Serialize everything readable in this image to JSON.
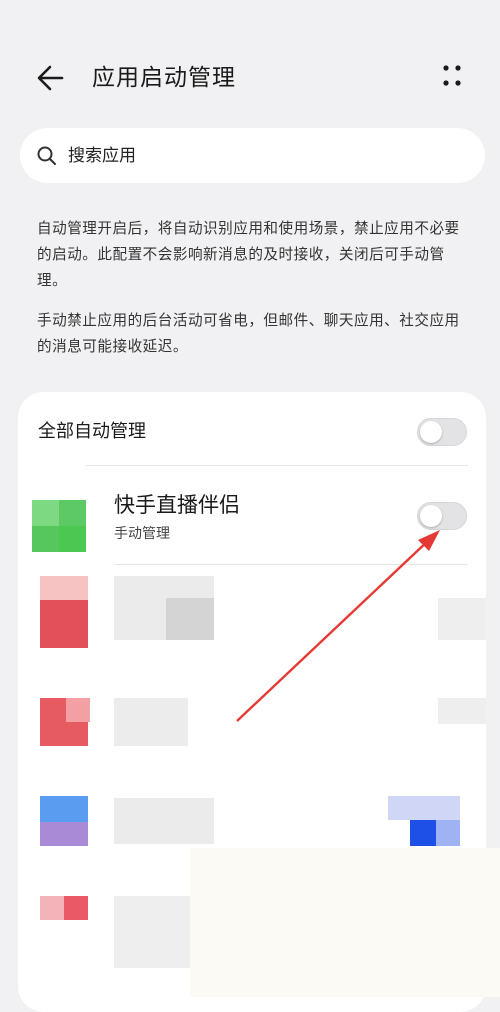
{
  "header": {
    "title": "应用启动管理"
  },
  "search": {
    "placeholder": "搜索应用"
  },
  "description": {
    "paragraph1": "自动管理开启后，将自动识别应用和使用场景，禁止应用不必要的启动。此配置不会影响新消息的及时接收，关闭后可手动管理。",
    "paragraph2": "手动禁止应用的后台活动可省电，但邮件、聊天应用、社交应用的消息可能接收延迟。"
  },
  "list": {
    "all_auto_label": "全部自动管理",
    "all_auto_on": false,
    "apps": [
      {
        "name": "快手直播伴侣",
        "status": "手动管理",
        "on": false
      }
    ]
  },
  "colors": {
    "background": "#f1f1f3",
    "card": "#ffffff",
    "arrow": "#e53935",
    "app_icon": "#4cc752"
  },
  "icons": {
    "back": "back-arrow-icon",
    "more": "more-dots-icon",
    "search": "search-icon"
  }
}
